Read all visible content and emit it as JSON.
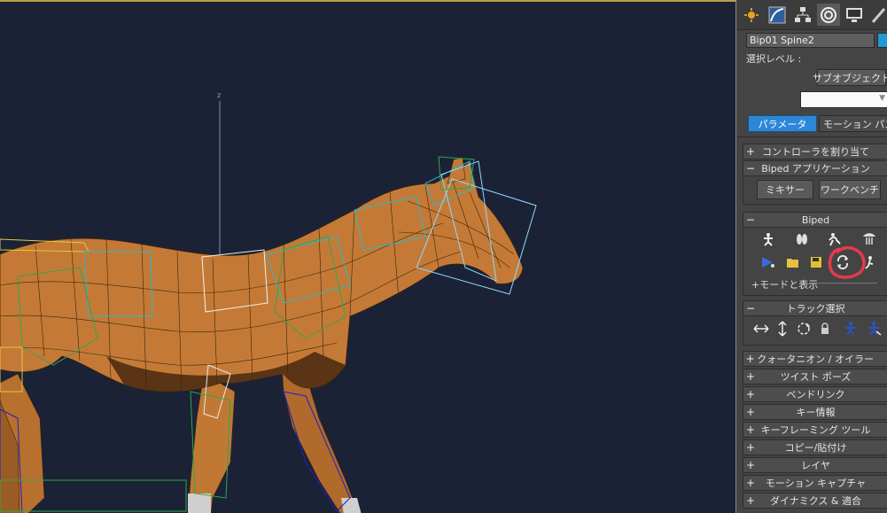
{
  "viewport": {
    "axis_label": "z"
  },
  "panel": {
    "tabs": [
      "create-icon",
      "modify-icon",
      "hierarchy-icon",
      "motion-icon",
      "display-icon",
      "utilities-icon"
    ],
    "object_name": "Bip01 Spine2",
    "accent_color": "#1f9bd3",
    "selection_level_label": "選択レベル :",
    "subobject_button": "サブオブジェクト",
    "subobject_dropdown_value": "",
    "mode_tabs": {
      "parameters": "パラメータ",
      "motion_paths": "モーション パス"
    },
    "rollouts": {
      "assign_controller": {
        "sign": "+",
        "title": "コントローラを割り当て"
      },
      "biped_apps": {
        "sign": "−",
        "title": "Biped アプリケーション",
        "mixer": "ミキサー",
        "workbench": "ワークベンチ"
      },
      "biped": {
        "sign": "−",
        "title": "Biped",
        "modes_display": "+モードと表示"
      },
      "track_selection": {
        "sign": "−",
        "title": "トラック選択"
      }
    },
    "collapsed_rollouts": [
      {
        "sign": "+",
        "title": "クォータニオン / オイラー"
      },
      {
        "sign": "+",
        "title": "ツイスト ポーズ"
      },
      {
        "sign": "+",
        "title": "ベンドリンク"
      },
      {
        "sign": "+",
        "title": "キー情報"
      },
      {
        "sign": "+",
        "title": "キーフレーミング ツール"
      },
      {
        "sign": "+",
        "title": "コピー/貼付け"
      },
      {
        "sign": "+",
        "title": "レイヤ"
      },
      {
        "sign": "+",
        "title": "モーション キャプチャ"
      },
      {
        "sign": "+",
        "title": "ダイナミクス & 適合"
      }
    ],
    "annotation_color": "#e8394a"
  }
}
